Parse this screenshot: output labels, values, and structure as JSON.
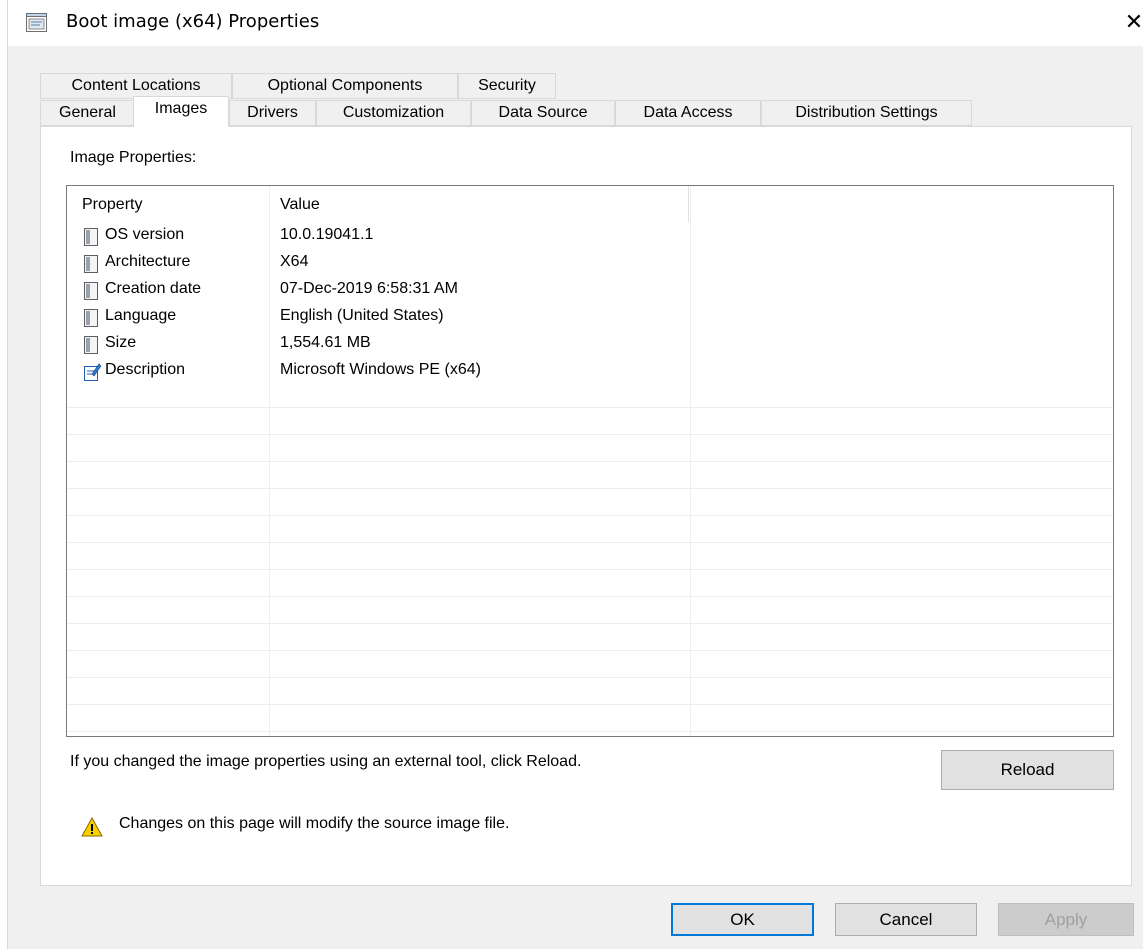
{
  "window": {
    "title": "Boot image (x64) Properties",
    "close_glyph": "✕",
    "icon": "properties-window-icon"
  },
  "tabs_row1": [
    {
      "label": "Content Locations"
    },
    {
      "label": "Optional Components"
    },
    {
      "label": "Security"
    }
  ],
  "tabs_row2": [
    {
      "label": "General"
    },
    {
      "label": "Images",
      "selected": true
    },
    {
      "label": "Drivers"
    },
    {
      "label": "Customization"
    },
    {
      "label": "Data Source"
    },
    {
      "label": "Data Access"
    },
    {
      "label": "Distribution Settings"
    }
  ],
  "images_page": {
    "section_label": "Image Properties:",
    "columns": [
      "Property",
      "Value"
    ],
    "rows": [
      {
        "icon": "document-icon",
        "property": "OS version",
        "value": "10.0.19041.1"
      },
      {
        "icon": "document-icon",
        "property": "Architecture",
        "value": "X64"
      },
      {
        "icon": "document-icon",
        "property": "Creation date",
        "value": "07-Dec-2019 6:58:31 AM"
      },
      {
        "icon": "document-icon",
        "property": "Language",
        "value": "English (United States)"
      },
      {
        "icon": "document-icon",
        "property": "Size",
        "value": "1,554.61 MB"
      },
      {
        "icon": "edit-document-icon",
        "property": "Description",
        "value": "Microsoft Windows PE (x64)"
      }
    ],
    "reload_hint": "If you changed the image properties using an external tool, click Reload.",
    "reload_label": "Reload",
    "warning_text": "Changes on this page will modify the source image file.",
    "warning_icon": "warning-icon"
  },
  "buttons": {
    "ok": "OK",
    "cancel": "Cancel",
    "apply": "Apply"
  },
  "colors": {
    "default_button_border": "#0078d7",
    "warning_yellow": "#f8d000"
  }
}
